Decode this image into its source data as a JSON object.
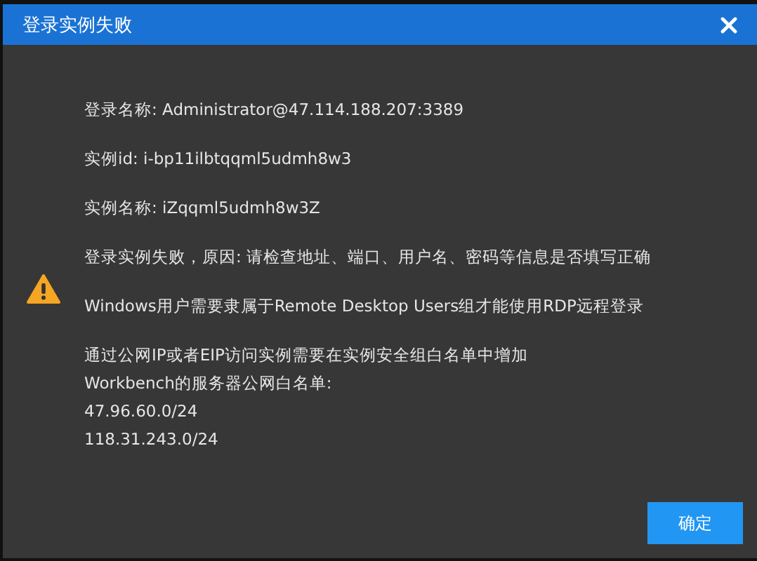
{
  "window": {
    "title": "登录实例失败"
  },
  "paragraphs": [
    [
      "登录名称: Administrator@47.114.188.207:3389"
    ],
    [
      "实例id: i-bp11ilbtqqml5udmh8w3"
    ],
    [
      "实例名称: iZqqml5udmh8w3Z"
    ],
    [
      "登录实例失败，原因: 请检查地址、端口、用户名、密码等信息是否填写正确"
    ],
    [
      "Windows用户需要隶属于Remote Desktop Users组才能使用RDP远程登录"
    ],
    [
      "通过公网IP或者EIP访问实例需要在实例安全组白名单中增加",
      "Workbench的服务器公网白名单:",
      "47.96.60.0/24",
      "118.31.243.0/24"
    ]
  ],
  "buttons": [
    "确定"
  ]
}
